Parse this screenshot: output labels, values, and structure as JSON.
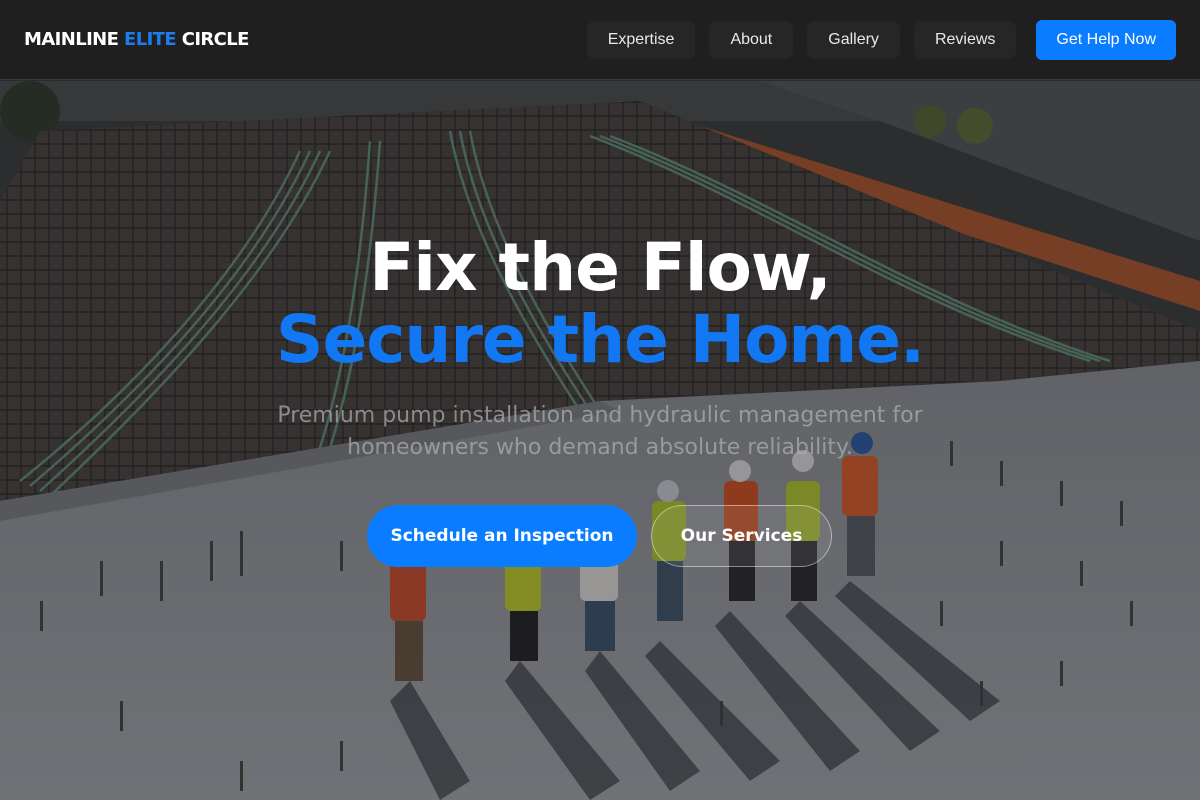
{
  "header": {
    "logo": {
      "part1": "MAINLINE ",
      "accent": "ELITE",
      "part2": " CIRCLE"
    },
    "nav": [
      {
        "label": "Expertise"
      },
      {
        "label": "About"
      },
      {
        "label": "Gallery"
      },
      {
        "label": "Reviews"
      }
    ],
    "cta_label": "Get Help Now"
  },
  "hero": {
    "headline_line1": "Fix the Flow,",
    "headline_line2": "Secure the Home.",
    "subtext": "Premium pump installation and hydraulic management for homeowners who demand absolute reliability.",
    "primary_button": "Schedule an Inspection",
    "secondary_button": "Our Services",
    "background_image": "aerial construction site with workers in hard hats and safety vests"
  },
  "colors": {
    "accent": "#0a7cff",
    "header_bg": "#1f1f1f",
    "headline_white": "#ffffff",
    "headline_blue": "#1177f2"
  }
}
